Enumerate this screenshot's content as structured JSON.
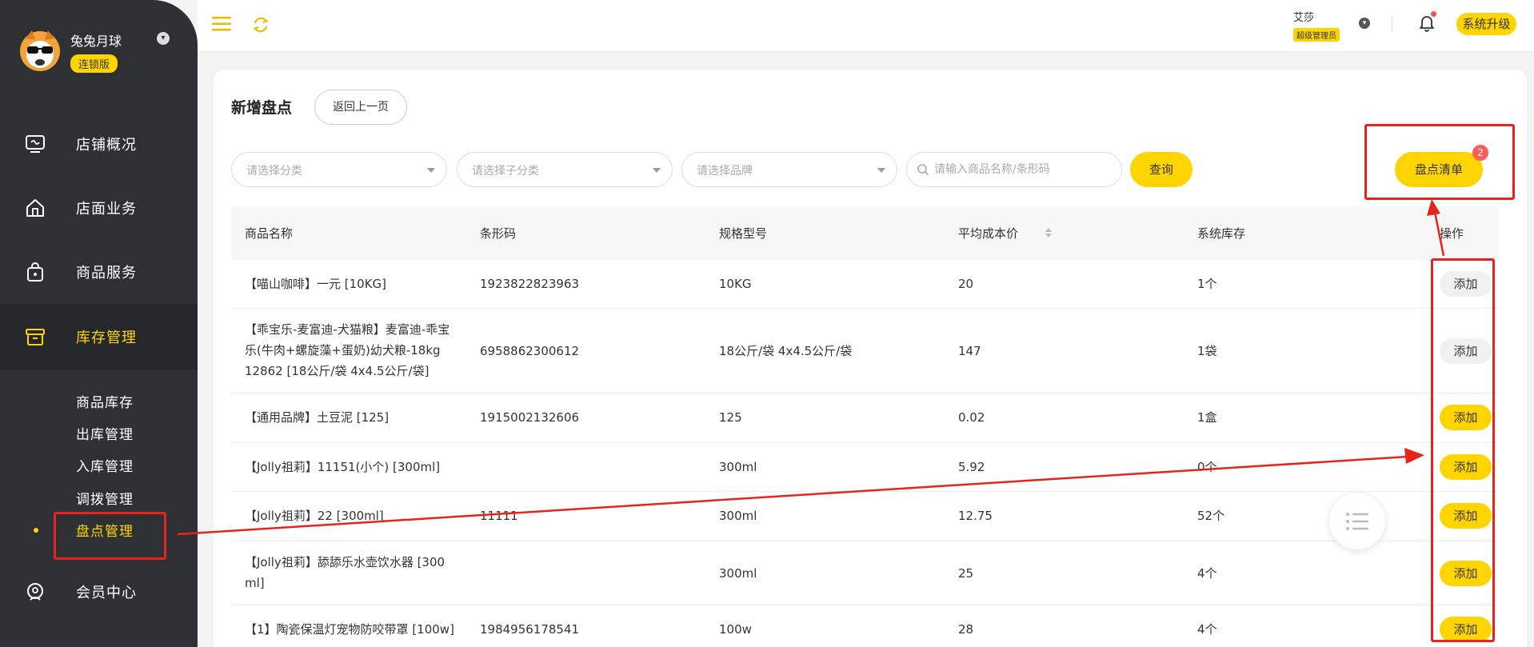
{
  "sidebar": {
    "brand_name": "兔兔月球",
    "brand_badge": "连锁版",
    "nav": [
      {
        "label": "店铺概况",
        "icon": "monitor-icon"
      },
      {
        "label": "店面业务",
        "icon": "house-icon"
      },
      {
        "label": "商品服务",
        "icon": "bag-icon"
      },
      {
        "label": "库存管理",
        "icon": "box-icon"
      },
      {
        "label": "会员中心",
        "icon": "member-icon"
      }
    ],
    "sub_items": [
      "商品库存",
      "出库管理",
      "入库管理",
      "调拨管理",
      "盘点管理"
    ]
  },
  "topbar": {
    "user_name": "艾莎",
    "user_role": "超级管理员",
    "upgrade_label": "系统升级"
  },
  "page": {
    "title": "新增盘点",
    "back_label": "返回上一页",
    "filters": {
      "category_placeholder": "请选择分类",
      "subcategory_placeholder": "请选择子分类",
      "brand_placeholder": "请选择品牌",
      "search_placeholder": "请输入商品名称/条形码",
      "query_label": "查询"
    },
    "list_button_label": "盘点清单",
    "list_badge": "2"
  },
  "table": {
    "headers": [
      "商品名称",
      "条形码",
      "规格型号",
      "平均成本价",
      "系统库存",
      "操作"
    ],
    "rows": [
      {
        "name": "【喵山咖啡】一元 [10KG]",
        "barcode": "1923822823963",
        "spec": "10KG",
        "cost": "20",
        "stock": "1个",
        "action": "添加",
        "enabled": false
      },
      {
        "name": "【乖宝乐-麦富迪-犬猫粮】麦富迪-乖宝乐(牛肉+螺旋藻+蛋奶)幼犬粮-18kg 12862 [18公斤/袋 4x4.5公斤/袋]",
        "barcode": "6958862300612",
        "spec": "18公斤/袋 4x4.5公斤/袋",
        "cost": "147",
        "stock": "1袋",
        "action": "添加",
        "enabled": false
      },
      {
        "name": "【通用品牌】土豆泥 [125]",
        "barcode": "1915002132606",
        "spec": "125",
        "cost": "0.02",
        "stock": "1盒",
        "action": "添加",
        "enabled": true
      },
      {
        "name": "【Jolly祖莉】11151(小个) [300ml]",
        "barcode": "",
        "spec": "300ml",
        "cost": "5.92",
        "stock": "0个",
        "action": "添加",
        "enabled": true
      },
      {
        "name": "【Jolly祖莉】22 [300ml]",
        "barcode": "11111",
        "spec": "300ml",
        "cost": "12.75",
        "stock": "52个",
        "action": "添加",
        "enabled": true
      },
      {
        "name": "【Jolly祖莉】舔舔乐水壶饮水器 [300 ml]",
        "barcode": "",
        "spec": "300ml",
        "cost": "25",
        "stock": "4个",
        "action": "添加",
        "enabled": true
      },
      {
        "name": "【1】陶瓷保温灯宠物防咬带罩 [100w]",
        "barcode": "1984956178541",
        "spec": "100w",
        "cost": "28",
        "stock": "4个",
        "action": "添加",
        "enabled": true
      }
    ]
  },
  "colors": {
    "accent": "#ffd500",
    "sidebar_bg": "#2f3033",
    "annotation": "#e8231d"
  }
}
